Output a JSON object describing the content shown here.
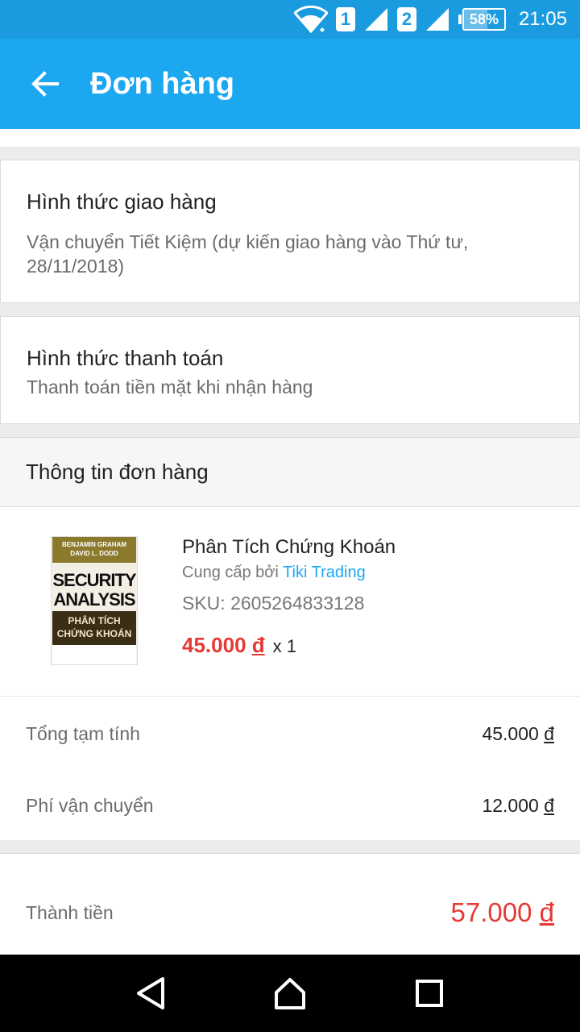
{
  "status_bar": {
    "sim1": "1",
    "sim2": "2",
    "battery_percent": "58%",
    "battery_level": 0.58,
    "time": "21:05",
    "icons": [
      "wifi-icon",
      "signal-icon",
      "signal-icon",
      "battery-icon"
    ]
  },
  "app_bar": {
    "title": "Đơn hàng",
    "back_icon": "arrow-left-icon"
  },
  "delivery": {
    "title": "Hình thức giao hàng",
    "detail": "Vận chuyển Tiết Kiệm (dự kiến giao hàng vào Thứ tư, 28/11/2018)"
  },
  "payment": {
    "title": "Hình thức thanh toán",
    "detail": "Thanh toán tiền mặt khi nhận hàng"
  },
  "order_info": {
    "header": "Thông tin đơn hàng",
    "product": {
      "cover_top": "BENJAMIN GRAHAM\nDAVID L. DODD",
      "cover_title1": "SECURITY",
      "cover_title2": "ANALYSIS",
      "cover_band": "PHÂN TÍCH\nCHỨNG KHOÁN",
      "name": "Phân Tích Chứng Khoán",
      "provider_prefix": "Cung cấp bởi",
      "provider_name": "Tiki Trading",
      "sku": "SKU: 2605264833128",
      "price_amount": "45.000",
      "currency": "đ",
      "quantity": "x 1"
    }
  },
  "totals": {
    "subtotal_label": "Tổng tạm tính",
    "subtotal_amount": "45.000",
    "shipping_label": "Phí vận chuyển",
    "shipping_amount": "12.000",
    "currency": "đ"
  },
  "grand_total": {
    "label": "Thành tiền",
    "amount": "57.000",
    "currency": "đ"
  },
  "colors": {
    "status_bar": "#1a9be0",
    "app_bar": "#1ba8f0",
    "price_red": "#e53935",
    "link_blue": "#1ba8f0"
  },
  "nav_bar": {
    "icons": [
      "back-triangle-icon",
      "home-icon",
      "recents-square-icon"
    ]
  }
}
